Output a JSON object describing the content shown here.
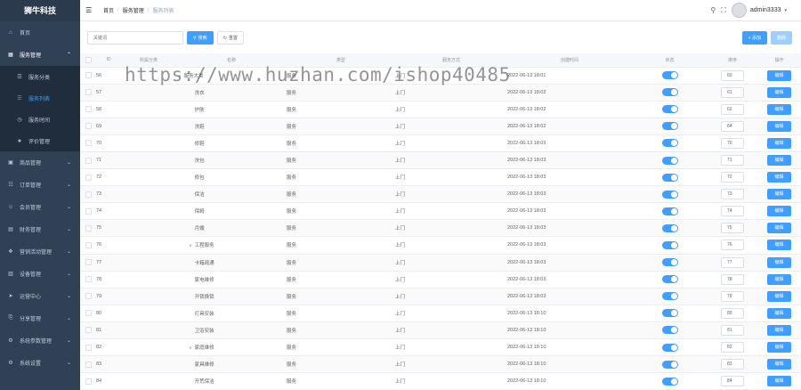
{
  "app": {
    "title": "狮牛科技"
  },
  "sidebar": {
    "items": [
      {
        "label": "首页",
        "icon": "home-icon"
      },
      {
        "label": "服务管理",
        "icon": "grid-icon",
        "open": true,
        "children": [
          {
            "label": "服务分类",
            "icon": "list-icon",
            "active": false
          },
          {
            "label": "服务列表",
            "icon": "list-icon",
            "active": true
          },
          {
            "label": "服务时间",
            "icon": "clock-icon",
            "active": false
          },
          {
            "label": "评价管理",
            "icon": "star-icon",
            "active": false
          }
        ]
      },
      {
        "label": "商品管理",
        "icon": "box-icon"
      },
      {
        "label": "订单管理",
        "icon": "order-icon"
      },
      {
        "label": "会员管理",
        "icon": "user-icon"
      },
      {
        "label": "财务管理",
        "icon": "wallet-icon"
      },
      {
        "label": "营销活动管理",
        "icon": "gift-icon"
      },
      {
        "label": "设备管理",
        "icon": "device-icon"
      },
      {
        "label": "运营中心",
        "icon": "send-icon"
      },
      {
        "label": "分享管理",
        "icon": "share-icon"
      },
      {
        "label": "系统参数管理",
        "icon": "setting-icon"
      },
      {
        "label": "系统设置",
        "icon": "gear-icon"
      }
    ]
  },
  "topbar": {
    "breadcrumb": [
      "首页",
      "服务管理",
      "服务列表"
    ],
    "username": "admin3333"
  },
  "toolbar": {
    "search_placeholder": "关键词",
    "search_label": "搜索",
    "reset_label": "重置",
    "add_label": "+ 添加",
    "delete_label": "删除"
  },
  "table": {
    "columns": [
      "ID",
      "所属分类",
      "名称",
      "类型",
      "服务方式",
      "创建时间",
      "状态",
      "排序",
      "操作"
    ],
    "rows": [
      {
        "id": "56",
        "name": "服务大类",
        "type": "服务",
        "mode": "上门",
        "time": "2022-06-13 18:01",
        "sort": "60",
        "op": "编辑",
        "expand": true,
        "indent": false
      },
      {
        "id": "57",
        "name": "洗衣",
        "type": "服务",
        "mode": "上门",
        "time": "2022-06-13 18:02",
        "sort": "61",
        "op": "编辑",
        "expand": false,
        "indent": true
      },
      {
        "id": "58",
        "name": "护肤",
        "type": "服务",
        "mode": "上门",
        "time": "2022-06-13 18:02",
        "sort": "62",
        "op": "编辑",
        "expand": false,
        "indent": true
      },
      {
        "id": "69",
        "name": "洗鞋",
        "type": "服务",
        "mode": "上门",
        "time": "2022-06-13 18:02",
        "sort": "64",
        "op": "编辑",
        "expand": false,
        "indent": true
      },
      {
        "id": "70",
        "name": "修鞋",
        "type": "服务",
        "mode": "上门",
        "time": "2022-06-13 18:03",
        "sort": "70",
        "op": "编辑",
        "expand": false,
        "indent": true
      },
      {
        "id": "71",
        "name": "洗包",
        "type": "服务",
        "mode": "上门",
        "time": "2022-06-13 18:03",
        "sort": "71",
        "op": "编辑",
        "expand": false,
        "indent": true
      },
      {
        "id": "72",
        "name": "修包",
        "type": "服务",
        "mode": "上门",
        "time": "2022-06-13 18:03",
        "sort": "72",
        "op": "编辑",
        "expand": false,
        "indent": true
      },
      {
        "id": "73",
        "name": "保洁",
        "type": "服务",
        "mode": "上门",
        "time": "2022-06-13 18:03",
        "sort": "73",
        "op": "编辑",
        "expand": false,
        "indent": true
      },
      {
        "id": "74",
        "name": "保姆",
        "type": "服务",
        "mode": "上门",
        "time": "2022-06-13 18:03",
        "sort": "74",
        "op": "编辑",
        "expand": false,
        "indent": true
      },
      {
        "id": "75",
        "name": "月嫂",
        "type": "服务",
        "mode": "上门",
        "time": "2022-06-13 18:03",
        "sort": "75",
        "op": "编辑",
        "expand": false,
        "indent": true
      },
      {
        "id": "76",
        "name": "工程服务",
        "type": "服务",
        "mode": "上门",
        "time": "2022-06-13 18:03",
        "sort": "76",
        "op": "编辑",
        "expand": true,
        "indent": true
      },
      {
        "id": "77",
        "name": "卡箱疏通",
        "type": "服务",
        "mode": "上门",
        "time": "2022-06-13 18:03",
        "sort": "77",
        "op": "编辑",
        "expand": false,
        "indent": true
      },
      {
        "id": "78",
        "name": "家电维修",
        "type": "服务",
        "mode": "上门",
        "time": "2022-06-13 18:03",
        "sort": "78",
        "op": "编辑",
        "expand": false,
        "indent": true
      },
      {
        "id": "79",
        "name": "开锁换锁",
        "type": "服务",
        "mode": "上门",
        "time": "2022-06-13 18:03",
        "sort": "79",
        "op": "编辑",
        "expand": false,
        "indent": true
      },
      {
        "id": "80",
        "name": "灯具安装",
        "type": "服务",
        "mode": "上门",
        "time": "2022-06-13 18:10",
        "sort": "80",
        "op": "编辑",
        "expand": false,
        "indent": true
      },
      {
        "id": "81",
        "name": "卫浴安装",
        "type": "服务",
        "mode": "上门",
        "time": "2022-06-13 18:10",
        "sort": "81",
        "op": "编辑",
        "expand": false,
        "indent": true
      },
      {
        "id": "82",
        "name": "家庭维修",
        "type": "服务",
        "mode": "上门",
        "time": "2022-06-13 18:10",
        "sort": "82",
        "op": "编辑",
        "expand": true,
        "indent": true
      },
      {
        "id": "83",
        "name": "家具维修",
        "type": "服务",
        "mode": "上门",
        "time": "2022-06-13 18:10",
        "sort": "83",
        "op": "编辑",
        "expand": false,
        "indent": true
      },
      {
        "id": "84",
        "name": "开荒保洁",
        "type": "服务",
        "mode": "上门",
        "time": "2022-06-13 18:10",
        "sort": "84",
        "op": "编辑",
        "expand": false,
        "indent": true
      }
    ]
  },
  "watermark": "https://www.huzhan.com/ishop40485",
  "colors": {
    "primary": "#409eff",
    "sidebar": "#304156"
  }
}
